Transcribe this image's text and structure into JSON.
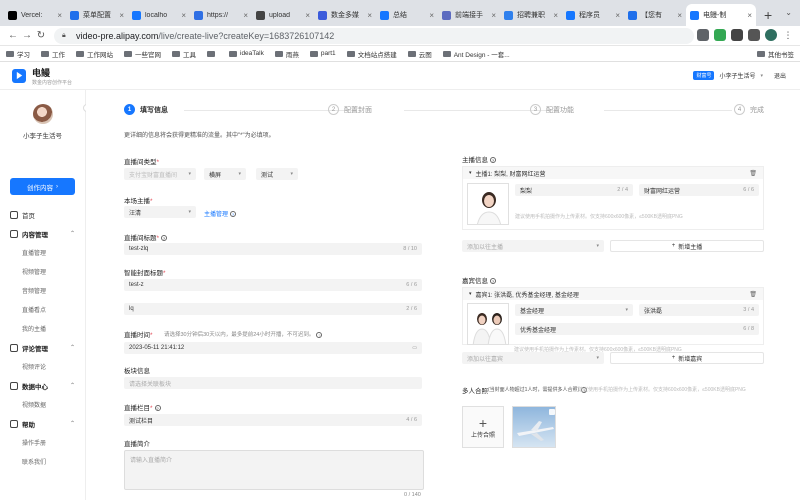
{
  "browser": {
    "tabs": [
      {
        "label": "Vercel:",
        "color": "#000000"
      },
      {
        "label": "菜单配置",
        "color": "#1f6feb"
      },
      {
        "label": "localho",
        "color": "#1677ff"
      },
      {
        "label": "https://",
        "color": "#2f6fe4"
      },
      {
        "label": "upload",
        "color": "#444444"
      },
      {
        "label": "数金多媒",
        "color": "#3b5bdb"
      },
      {
        "label": "总结",
        "color": "#1677ff"
      },
      {
        "label": "前端接手",
        "color": "#5c6bc0"
      },
      {
        "label": "招聘兼职",
        "color": "#2f80ed"
      },
      {
        "label": "程序员",
        "color": "#1677ff"
      },
      {
        "label": "【您有",
        "color": "#1f6feb"
      },
      {
        "label": "电鳗-制",
        "color": "#1677ff"
      }
    ],
    "url_host": "video-pre.alipay.com",
    "url_path": "/live/create-live?createKey=1683726107142",
    "bookmarks": [
      "学习",
      "工作",
      "工作网站",
      "一些官网",
      "工具",
      "",
      "ideaTalk",
      "雨燕",
      "part1",
      "文档站点搭建",
      "云图",
      "Ant Design - 一套..."
    ],
    "bookmarks_end": "其他书签"
  },
  "app": {
    "name": "电鳗",
    "subtitle": "数金内容创作平台",
    "user_badge": "财富号",
    "user_name": "小李子生活号",
    "logout": "退出"
  },
  "sidebar": {
    "profile_name": "小李子生活号",
    "create_button": "创作内容",
    "items": [
      {
        "label": "首页",
        "type": "top"
      },
      {
        "label": "内容管理",
        "type": "group"
      },
      {
        "label": "直播管理",
        "type": "sub"
      },
      {
        "label": "视频管理",
        "type": "sub"
      },
      {
        "label": "音频管理",
        "type": "sub"
      },
      {
        "label": "直播看点",
        "type": "sub"
      },
      {
        "label": "我的主播",
        "type": "sub"
      },
      {
        "label": "评论管理",
        "type": "group"
      },
      {
        "label": "视频评论",
        "type": "sub"
      },
      {
        "label": "数据中心",
        "type": "group"
      },
      {
        "label": "视频数据",
        "type": "sub"
      },
      {
        "label": "帮助",
        "type": "group"
      },
      {
        "label": "操作手册",
        "type": "sub"
      },
      {
        "label": "联系我们",
        "type": "sub"
      }
    ]
  },
  "steps": [
    {
      "num": "1",
      "label": "填写信息",
      "active": true
    },
    {
      "num": "2",
      "label": "配置封面",
      "active": false
    },
    {
      "num": "3",
      "label": "配置功能",
      "active": false
    },
    {
      "num": "4",
      "label": "完成",
      "active": false
    }
  ],
  "form": {
    "hint": "更详细的信息将会获得更精准的流量。其中\"*\"为必填项。",
    "room_type_label": "直播间类型",
    "room_type_value": "支付宝财富直播间",
    "room_orientation": "横屏",
    "room_test": "测试",
    "host_label": "本场主播",
    "host_value": "汪清",
    "host_manage": "主播管理",
    "title_label": "直播间标题",
    "title_value": "test-zlq",
    "title_count": "8 / 10",
    "cover_title_label": "智能封面标题",
    "cover_title_1": "test-z",
    "cover_title_1_count": "6 / 6",
    "cover_title_2": "lq",
    "cover_title_2_count": "2 / 6",
    "time_label": "直播时间",
    "time_note": "请选择30分钟后30天以内，最多提前24小时开播，不可迟到。",
    "time_value": "2023-05-11 21:41:12",
    "block_label": "板块信息",
    "block_placeholder": "请选择关联板块",
    "column_label": "直播栏目",
    "column_value": "测试栏目",
    "column_count": "4 / 6",
    "intro_label": "直播简介",
    "intro_placeholder": "请输入直播简介",
    "intro_count": "0 / 140"
  },
  "right": {
    "host_info_label": "主播信息",
    "host_card_title": "主播1: 梨梨, 财富网红运营",
    "host_name": "梨梨",
    "host_name_count": "2 / 4",
    "host_role": "财富网红运营",
    "host_role_count": "6 / 6",
    "host_photo_note": "建议使用手机拍摄作为上传素材。仅支持600x600像素，≤500KB透明底PNG",
    "add_host_placeholder": "添加以往主播",
    "add_host_button": "新增主播",
    "guest_info_label": "嘉宾信息",
    "guest_card_title": "嘉宾1: 张洪磊, 优秀基金经理, 基金经理",
    "guest_role": "基金经理",
    "guest_name": "张洪磊",
    "guest_name_count": "3 / 4",
    "guest_title": "优秀基金经理",
    "guest_title_count": "6 / 8",
    "guest_photo_note": "建议使用手机拍摄作为上传素材。仅支持600x600像素，≤500KB透明底PNG",
    "add_guest_placeholder": "添加以往嘉宾",
    "add_guest_button": "新增嘉宾",
    "group_photo_label": "多人合照",
    "group_photo_note": "(当封面人物超过1人时，需提供多人合照)",
    "group_photo_note2": "建议使用手机拍摄作为上传素材。仅支持600x600像素，≤500KB透明底PNG",
    "upload_label": "上传合照"
  },
  "colors": {
    "accent": "#1677ff",
    "required": "#e34d59"
  }
}
